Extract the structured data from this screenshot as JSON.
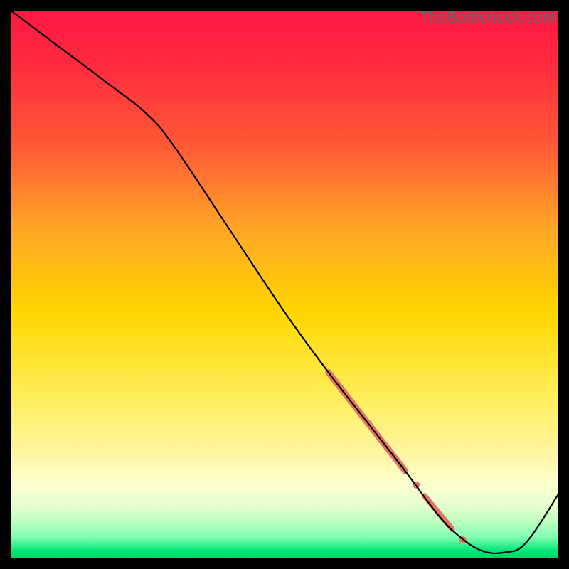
{
  "watermark": "TheBottleneck.com",
  "chart_data": {
    "type": "line",
    "title": "",
    "xlabel": "",
    "ylabel": "",
    "xlim": [
      0,
      100
    ],
    "ylim": [
      0,
      100
    ],
    "gradient_stops": [
      {
        "offset": 0.0,
        "color": "#ff1744"
      },
      {
        "offset": 0.1,
        "color": "#ff2b3f"
      },
      {
        "offset": 0.25,
        "color": "#ff5a36"
      },
      {
        "offset": 0.4,
        "color": "#ffa726"
      },
      {
        "offset": 0.55,
        "color": "#ffd600"
      },
      {
        "offset": 0.7,
        "color": "#ffee58"
      },
      {
        "offset": 0.8,
        "color": "#fff59d"
      },
      {
        "offset": 0.86,
        "color": "#ffffcc"
      },
      {
        "offset": 0.9,
        "color": "#e8ffd0"
      },
      {
        "offset": 0.93,
        "color": "#c0ffc0"
      },
      {
        "offset": 0.96,
        "color": "#80ffb0"
      },
      {
        "offset": 0.985,
        "color": "#00e676"
      },
      {
        "offset": 1.0,
        "color": "#00d068"
      }
    ],
    "series": [
      {
        "name": "curve",
        "color": "#000000",
        "x": [
          0.0,
          8.0,
          18.0,
          25.0,
          30.0,
          40.0,
          50.0,
          58.0,
          65.0,
          72.0,
          78.0,
          82.0,
          86.0,
          90.0,
          94.0,
          100.0
        ],
        "y": [
          100.0,
          94.0,
          86.5,
          81.0,
          75.0,
          60.0,
          45.0,
          34.0,
          25.0,
          16.0,
          8.0,
          4.0,
          1.5,
          1.2,
          3.0,
          12.0
        ]
      }
    ],
    "markers": [
      {
        "name": "highlight-thick-segment",
        "color": "#e57368",
        "type": "thick-line",
        "width": 9,
        "x": [
          58.0,
          72.0
        ],
        "y": [
          34.0,
          16.0
        ]
      },
      {
        "name": "highlight-dot-1",
        "color": "#e57368",
        "type": "dot",
        "r": 5,
        "x": 74.0,
        "y": 13.5
      },
      {
        "name": "highlight-short-segment",
        "color": "#e57368",
        "type": "thick-line",
        "width": 8,
        "x": [
          75.5,
          80.5
        ],
        "y": [
          11.5,
          5.5
        ]
      },
      {
        "name": "highlight-dot-2",
        "color": "#e57368",
        "type": "dot",
        "r": 5,
        "x": 82.5,
        "y": 3.5
      }
    ]
  }
}
